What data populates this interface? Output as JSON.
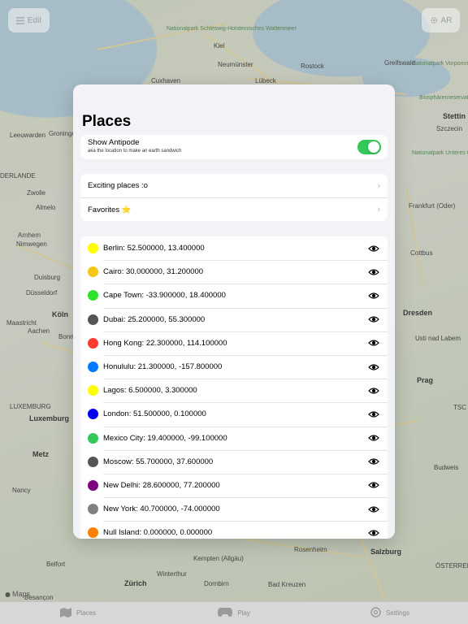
{
  "top_bar": {
    "edit_label": "Edit",
    "ar_label": "AR"
  },
  "map": {
    "credit": "Maps",
    "labels": [
      {
        "text": "Kiel",
        "cls": "city"
      },
      {
        "text": "Lübeck",
        "cls": "city"
      },
      {
        "text": "Rostock",
        "cls": "city"
      },
      {
        "text": "Cuxhaven",
        "cls": "city"
      },
      {
        "text": "Neumünster",
        "cls": "city"
      },
      {
        "text": "Greifswald",
        "cls": "city"
      },
      {
        "text": "Stettin",
        "cls": "city big"
      },
      {
        "text": "Szczecin",
        "cls": "city"
      },
      {
        "text": "Groningen",
        "cls": "city"
      },
      {
        "text": "Leeuwarden",
        "cls": "city"
      },
      {
        "text": "DERLANDE",
        "cls": "city"
      },
      {
        "text": "Zwolle",
        "cls": "city"
      },
      {
        "text": "Almelo",
        "cls": "city"
      },
      {
        "text": "Arnhem",
        "cls": "city"
      },
      {
        "text": "Nimwegen",
        "cls": "city"
      },
      {
        "text": "Duisburg",
        "cls": "city"
      },
      {
        "text": "Düsseldorf",
        "cls": "city"
      },
      {
        "text": "Köln",
        "cls": "city big"
      },
      {
        "text": "Maastricht",
        "cls": "city"
      },
      {
        "text": "Aachen",
        "cls": "city"
      },
      {
        "text": "Bonn",
        "cls": "city"
      },
      {
        "text": "LUXEMBURG",
        "cls": "city"
      },
      {
        "text": "Luxemburg",
        "cls": "city big"
      },
      {
        "text": "Metz",
        "cls": "city big"
      },
      {
        "text": "Nancy",
        "cls": "city"
      },
      {
        "text": "Frankfurt (Oder)",
        "cls": "city"
      },
      {
        "text": "Cottbus",
        "cls": "city"
      },
      {
        "text": "Dresden",
        "cls": "city big"
      },
      {
        "text": "Usti nad Labem",
        "cls": "city"
      },
      {
        "text": "Prag",
        "cls": "city big"
      },
      {
        "text": "TSC",
        "cls": "city"
      },
      {
        "text": "Budweis",
        "cls": "city"
      },
      {
        "text": "Salzburg",
        "cls": "city big"
      },
      {
        "text": "ÖSTERREICH",
        "cls": "city"
      },
      {
        "text": "Rosenheim",
        "cls": "city"
      },
      {
        "text": "Zürich",
        "cls": "city big"
      },
      {
        "text": "Kempten (Allgäu)",
        "cls": "city"
      },
      {
        "text": "Winterthur",
        "cls": "city"
      },
      {
        "text": "Dornbirn",
        "cls": "city"
      },
      {
        "text": "Belfort",
        "cls": "city"
      },
      {
        "text": "Besançon",
        "cls": "city"
      },
      {
        "text": "Nationalpark Schleswig-Holsteinisches Wattenmeer",
        "cls": "city green"
      },
      {
        "text": "Biosphärenreservat Südost-Rügen",
        "cls": "city green"
      },
      {
        "text": "Nationalpark Unteres Odertal",
        "cls": "city green"
      },
      {
        "text": "Bad Kreuzen",
        "cls": "city"
      },
      {
        "text": "Nationalpark Vorpommersche Boddenlandschaft",
        "cls": "city green"
      }
    ]
  },
  "sheet": {
    "title": "Places",
    "antipode": {
      "title": "Show Antipode",
      "subtitle": "aka the location to make an earth sandwich",
      "enabled": true
    },
    "lists": [
      {
        "label": "Exciting places :o"
      },
      {
        "label": "Favorites ⭐️"
      }
    ],
    "places": [
      {
        "label": "Berlin: 52.500000, 13.400000",
        "color": "#ffff00"
      },
      {
        "label": "Cairo: 30.000000, 31.200000",
        "color": "#f5c518"
      },
      {
        "label": "Cape Town: -33.900000, 18.400000",
        "color": "#2de12d"
      },
      {
        "label": "Dubai: 25.200000, 55.300000",
        "color": "#555555"
      },
      {
        "label": "Hong Kong: 22.300000, 114.100000",
        "color": "#ff3b30"
      },
      {
        "label": "Honululu: 21.300000, -157.800000",
        "color": "#007aff"
      },
      {
        "label": "Lagos: 6.500000, 3.300000",
        "color": "#ffff00"
      },
      {
        "label": "London: 51.500000, 0.100000",
        "color": "#0000f0"
      },
      {
        "label": "Mexico City: 19.400000, -99.100000",
        "color": "#34c759"
      },
      {
        "label": "Moscow: 55.700000, 37.600000",
        "color": "#555555"
      },
      {
        "label": "New Delhi: 28.600000, 77.200000",
        "color": "#7d007d"
      },
      {
        "label": "New York: 40.700000, -74.000000",
        "color": "#808080"
      },
      {
        "label": "Null Island: 0.000000, 0.000000",
        "color": "#ff8000"
      }
    ]
  },
  "tabbar": {
    "tabs": [
      {
        "label": "Places",
        "icon": "map-icon"
      },
      {
        "label": "Play",
        "icon": "gamecontroller-icon"
      },
      {
        "label": "Settings",
        "icon": "gear-icon"
      }
    ]
  }
}
